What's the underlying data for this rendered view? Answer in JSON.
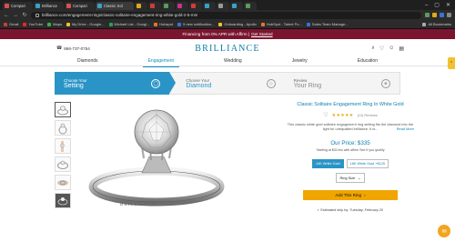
{
  "browser": {
    "tabs": [
      {
        "title": "Compari",
        "color": "#d94f4f"
      },
      {
        "title": "Brilliance",
        "color": "#3aa0c9"
      },
      {
        "title": "Compari",
        "color": "#d94f4f"
      },
      {
        "title": "Classic Sol",
        "color": "#3aa0c9",
        "active": true
      },
      {
        "title": "",
        "color": "#e0a91a"
      },
      {
        "title": "",
        "color": "#d33b3b"
      },
      {
        "title": "",
        "color": "#5b9b5b"
      },
      {
        "title": "",
        "color": "#c9338f"
      },
      {
        "title": "",
        "color": "#d33b3b"
      },
      {
        "title": "",
        "color": "#3aa0c9"
      },
      {
        "title": "",
        "color": "#999999"
      },
      {
        "title": "",
        "color": "#3aa0c9"
      },
      {
        "title": "",
        "color": "#5b9b5b"
      }
    ],
    "url": "brilliance.com/engagement-rings/classic-solitaire-engagement-ring-white-gold-2-5-mm",
    "bookmarks": [
      {
        "label": "Gmail",
        "color": "#d33b3b"
      },
      {
        "label": "YouTube",
        "color": "#e22b2b"
      },
      {
        "label": "Maps",
        "color": "#3bb24a"
      },
      {
        "label": "My Drive - Google...",
        "color": "#f2c12e"
      },
      {
        "label": "Michael List - Googl...",
        "color": "#2ba34a"
      },
      {
        "label": "Hubspot",
        "color": "#f0702a"
      },
      {
        "label": "5 new notification...",
        "color": "#3a73d9"
      },
      {
        "label": "Onboarding - Apollo",
        "color": "#f2c12e"
      },
      {
        "label": "HubSpot - Talent Po...",
        "color": "#f0702a"
      },
      {
        "label": "Sales Team Manage...",
        "color": "#3a73d9"
      }
    ],
    "all_bookmarks": "All Bookmarks"
  },
  "promo": {
    "text": "Financing from 0% APR with Affirm |",
    "link": "Get Started"
  },
  "header": {
    "phone": "866-737-0754",
    "logo": "BRILLIANCE",
    "nav": [
      "Diamonds",
      "Engagement",
      "Wedding",
      "Jewelry",
      "Education"
    ],
    "active_nav": "Engagement"
  },
  "steps": [
    {
      "sub": "Choose Your",
      "main": "Setting"
    },
    {
      "sub": "Choose Your",
      "main": "Diamond"
    },
    {
      "sub": "Review",
      "main": "Your Ring"
    }
  ],
  "product": {
    "title": "Classic Solitaire Engagement Ring In White Gold",
    "stars": "★★★★★",
    "reviews": "(13) Reviews",
    "description": "This classic white gold solitaire engagement ring setting fits the diamond into the light for unequalled brilliance. It w...",
    "read_more": "Read More",
    "price": "Our Price: $335",
    "affordability": "Starting at $31/mo with affirm  See if you qualify",
    "metals": [
      "14K White Gold",
      "18K White Gold +$125"
    ],
    "ring_size": "Ring Size",
    "add_button": "Add This Ring",
    "estimate": "Estimated ship by: Tuesday, February 20",
    "watermark": "BRILLIANCE"
  },
  "colors": {
    "promo_bg": "#7a1530",
    "brand_blue": "#2a94c6",
    "add_button": "#f0a500"
  }
}
